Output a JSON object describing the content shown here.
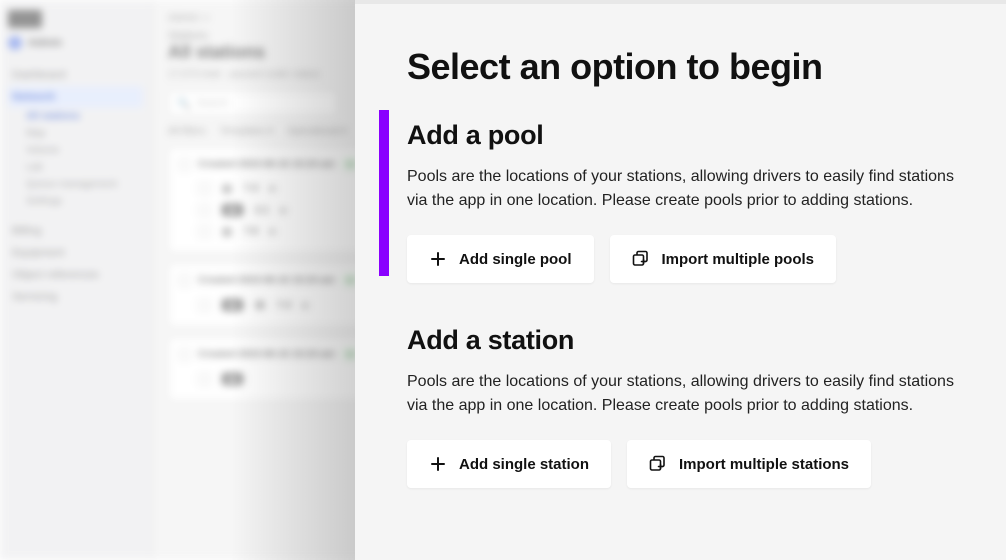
{
  "bg": {
    "crumb": "Admin ››",
    "section_label": "Stations",
    "page_title": "All stations",
    "meta": "17,073 total · paused under status",
    "search_placeholder": "Search",
    "filters": [
      "All filters",
      "Templates ▾",
      "Operational ▾"
    ],
    "sidebar": {
      "account": "Admin",
      "items": [
        "Dashboard",
        "Network",
        "Billing",
        "Equipment",
        "Object references",
        "Servicing"
      ],
      "sub": [
        "All stations",
        "Map",
        "Volume",
        "Lab",
        "Queue management",
        "Settings"
      ]
    },
    "cards": [
      {
        "title": "Created 2023-06-16 10:24 am",
        "status": "●",
        "rows": [
          {
            "val": "7.4",
            "rt": "45%"
          },
          {
            "val": "2.1",
            "rt": ""
          },
          {
            "val": "7.6",
            "rt": ""
          }
        ]
      },
      {
        "title": "Created 2023-06-16 10:24 am",
        "status": "●",
        "rows": [
          {
            "val": "7.4",
            "rt": ""
          }
        ]
      },
      {
        "title": "Created 2023-06-16 10:24 am",
        "status": "●",
        "rows": []
      }
    ]
  },
  "panel": {
    "heading": "Select an option to begin",
    "pool": {
      "title": "Add a pool",
      "desc": "Pools are the locations of your stations, allowing drivers to easily find stations via the app in one location. Please create pools prior to adding stations.",
      "add_label": "Add single pool",
      "import_label": "Import multiple pools"
    },
    "station": {
      "title": "Add a station",
      "desc": "Pools are the locations of your stations, allowing drivers to easily find stations via the app in one location. Please create pools prior to adding stations.",
      "add_label": "Add single station",
      "import_label": "Import multiple stations"
    }
  }
}
